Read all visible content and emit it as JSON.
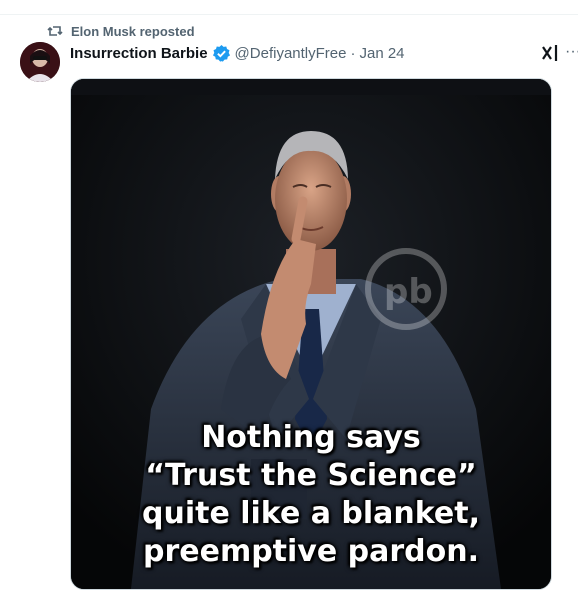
{
  "repost": {
    "label": "Elon Musk reposted",
    "icon": "repost-icon"
  },
  "author": {
    "display_name": "Insurrection Barbie",
    "verified_icon": "verified-badge-icon",
    "handle": "@DefiyantlyFree",
    "separator": "·",
    "date": "Jan 24"
  },
  "actions": {
    "grok_icon": "grok-icon",
    "more_icon": "more-icon",
    "more_label": "···"
  },
  "media": {
    "caption_lines": [
      "Nothing says",
      "“Trust the Science”",
      "quite like a blanket,",
      "preemptive pardon."
    ],
    "watermark_icon": "pb-watermark-icon"
  },
  "colors": {
    "accent": "#1d9bf0",
    "muted": "#536471",
    "text": "#0f1419"
  }
}
